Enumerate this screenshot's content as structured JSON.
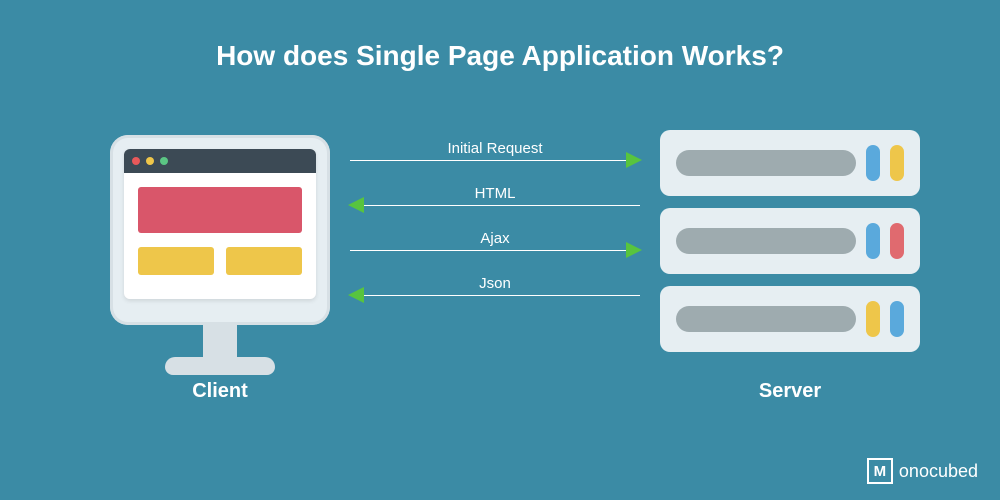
{
  "title": "How does Single Page Application Works?",
  "client_label": "Client",
  "server_label": "Server",
  "arrows": [
    {
      "label": "Initial Request",
      "direction": "right"
    },
    {
      "label": "HTML",
      "direction": "left"
    },
    {
      "label": "Ajax",
      "direction": "right"
    },
    {
      "label": "Json",
      "direction": "left"
    }
  ],
  "server_units": [
    {
      "lights": [
        "blue",
        "yellow"
      ]
    },
    {
      "lights": [
        "blue",
        "red"
      ]
    },
    {
      "lights": [
        "yellow",
        "blue"
      ]
    }
  ],
  "logo_text": "onocubed",
  "logo_letter": "M"
}
